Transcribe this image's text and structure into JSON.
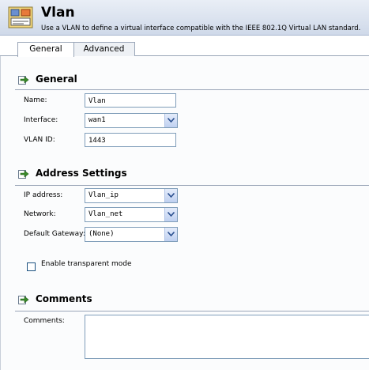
{
  "header": {
    "title": "Vlan",
    "description": "Use a VLAN to define a virtual interface compatible with the IEEE 802.1Q Virtual LAN standard.",
    "icon": "vlan-icon"
  },
  "tabs": [
    {
      "label": "General",
      "active": true
    },
    {
      "label": "Advanced",
      "active": false
    }
  ],
  "sections": {
    "general": {
      "title": "General",
      "name_label": "Name:",
      "name_value": "Vlan",
      "interface_label": "Interface:",
      "interface_value": "wan1",
      "vlanid_label": "VLAN ID:",
      "vlanid_value": "1443"
    },
    "address": {
      "title": "Address Settings",
      "ip_label": "IP address:",
      "ip_value": "Vlan_ip",
      "network_label": "Network:",
      "network_value": "Vlan_net",
      "gateway_label": "Default Gateway:",
      "gateway_value": "(None)",
      "transparent_label": "Enable transparent mode",
      "transparent_checked": false
    },
    "comments": {
      "title": "Comments",
      "comments_label": "Comments:",
      "comments_value": ""
    }
  },
  "colors": {
    "header_bg": "#d8e1ef",
    "accent": "#7f9db9",
    "section_arrow": "#3a8a2a"
  }
}
